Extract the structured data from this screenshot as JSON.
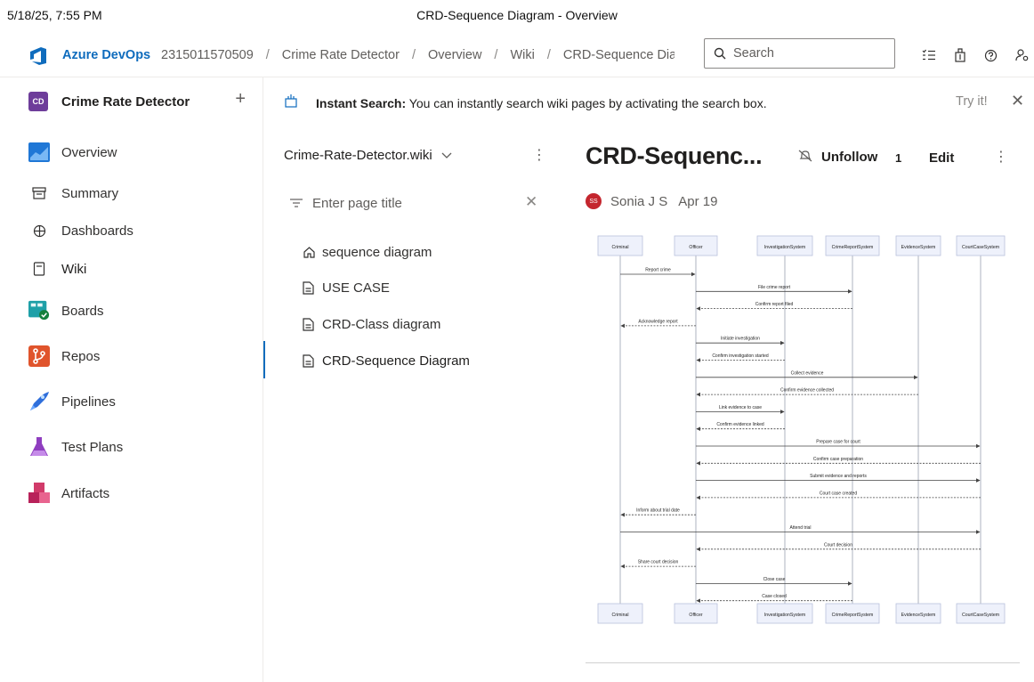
{
  "print_header": {
    "datetime": "5/18/25, 7:55 PM",
    "title": "CRD-Sequence Diagram - Overview"
  },
  "topbar": {
    "brand": "Azure DevOps",
    "breadcrumbs": [
      "2315011570509",
      "Crime Rate Detector",
      "Overview",
      "Wiki",
      "CRD-Sequence Diagram"
    ],
    "search_placeholder": "Search"
  },
  "project": {
    "initials": "CD",
    "name": "Crime Rate Detector",
    "add_label": "+"
  },
  "nav": {
    "overview": "Overview",
    "summary": "Summary",
    "dashboards": "Dashboards",
    "wiki": "Wiki",
    "boards": "Boards",
    "repos": "Repos",
    "pipelines": "Pipelines",
    "test_plans": "Test Plans",
    "artifacts": "Artifacts"
  },
  "banner": {
    "title": "Instant Search:",
    "text": " You can instantly search wiki pages by activating the search box.",
    "try_it": "Try it!"
  },
  "wiki": {
    "name": "Crime-Rate-Detector.wiki",
    "filter_placeholder": "Enter page title",
    "pages": [
      "sequence diagram",
      "USE CASE",
      "CRD-Class diagram",
      "CRD-Sequence Diagram"
    ]
  },
  "page": {
    "title": "CRD-Sequenc...",
    "unfollow_label": "Unfollow",
    "follow_count": "1",
    "edit_label": "Edit",
    "author_initials": "SS",
    "author": "Sonia J S",
    "date": "Apr 19"
  },
  "sequence_diagram": {
    "participants": [
      "Criminal",
      "Officer",
      "InvestigationSystem",
      "CrimeReportSystem",
      "EvidenceSystem",
      "CourtCaseSystem"
    ],
    "messages": [
      {
        "from": 0,
        "to": 1,
        "text": "Report crime",
        "reply": false
      },
      {
        "from": 1,
        "to": 3,
        "text": "File crime report",
        "reply": false
      },
      {
        "from": 3,
        "to": 1,
        "text": "Confirm report filed",
        "reply": true
      },
      {
        "from": 1,
        "to": 0,
        "text": "Acknowledge report",
        "reply": true
      },
      {
        "from": 1,
        "to": 2,
        "text": "Initiate investigation",
        "reply": false
      },
      {
        "from": 2,
        "to": 1,
        "text": "Confirm investigation started",
        "reply": true
      },
      {
        "from": 1,
        "to": 4,
        "text": "Collect evidence",
        "reply": false
      },
      {
        "from": 4,
        "to": 1,
        "text": "Confirm evidence collected",
        "reply": true
      },
      {
        "from": 1,
        "to": 2,
        "text": "Link evidence to case",
        "reply": false
      },
      {
        "from": 2,
        "to": 1,
        "text": "Confirm evidence linked",
        "reply": true
      },
      {
        "from": 1,
        "to": 5,
        "text": "Prepare case for court",
        "reply": false
      },
      {
        "from": 5,
        "to": 1,
        "text": "Confirm case preparation",
        "reply": true
      },
      {
        "from": 1,
        "to": 5,
        "text": "Submit evidence and reports",
        "reply": false
      },
      {
        "from": 5,
        "to": 1,
        "text": "Court case created",
        "reply": true
      },
      {
        "from": 1,
        "to": 0,
        "text": "Inform about trial date",
        "reply": true
      },
      {
        "from": 0,
        "to": 5,
        "text": "Attend trial",
        "reply": false
      },
      {
        "from": 5,
        "to": 1,
        "text": "Court decision",
        "reply": true
      },
      {
        "from": 1,
        "to": 0,
        "text": "Share court decision",
        "reply": true
      },
      {
        "from": 1,
        "to": 3,
        "text": "Close case",
        "reply": false
      },
      {
        "from": 3,
        "to": 1,
        "text": "Case closed",
        "reply": true
      }
    ]
  },
  "colors": {
    "accent": "#0f6cbd",
    "participant_fill": "#eef1fb",
    "participant_border": "#b9c1dd",
    "line": "#444444"
  }
}
